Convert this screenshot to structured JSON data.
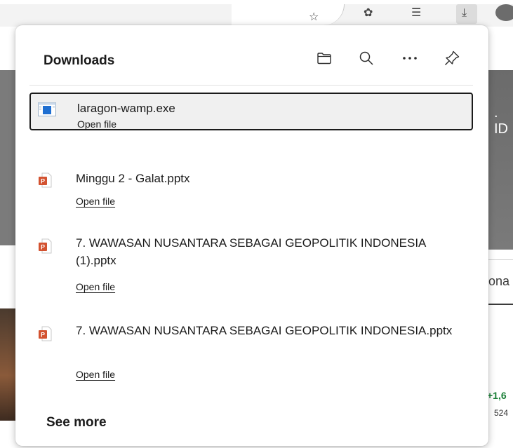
{
  "browser": {
    "toolbar_icons": [
      "star-icon",
      "extensions-icon",
      "favorites-icon",
      "downloads-icon"
    ],
    "background": {
      "right_heading_text": ". ID",
      "right_tab_text": "ona",
      "stock_change": "+1,6",
      "stock_value": "524"
    }
  },
  "downloads": {
    "title": "Downloads",
    "header_icons": [
      "folder-icon",
      "search-icon",
      "more-options-icon",
      "pin-icon"
    ],
    "items": [
      {
        "name": "laragon-wamp.exe",
        "action": "Open file",
        "file_icon": "exe-file-icon",
        "selected": true
      },
      {
        "name": "Minggu 2 - Galat.pptx",
        "action": "Open file",
        "file_icon": "pptx-file-icon"
      },
      {
        "name": "7. WAWASAN NUSANTARA SEBAGAI GEOPOLITIK INDONESIA (1).pptx",
        "action": "Open file",
        "file_icon": "pptx-file-icon"
      },
      {
        "name": "7. WAWASAN NUSANTARA SEBAGAI GEOPOLITIK INDONESIA.pptx",
        "action": "Open file",
        "file_icon": "pptx-file-icon"
      }
    ],
    "see_more": "See more",
    "colors": {
      "pptx_orange": "#d35230",
      "exe_blue": "#1f6fd1",
      "focus_border": "#1b1b1b"
    }
  }
}
